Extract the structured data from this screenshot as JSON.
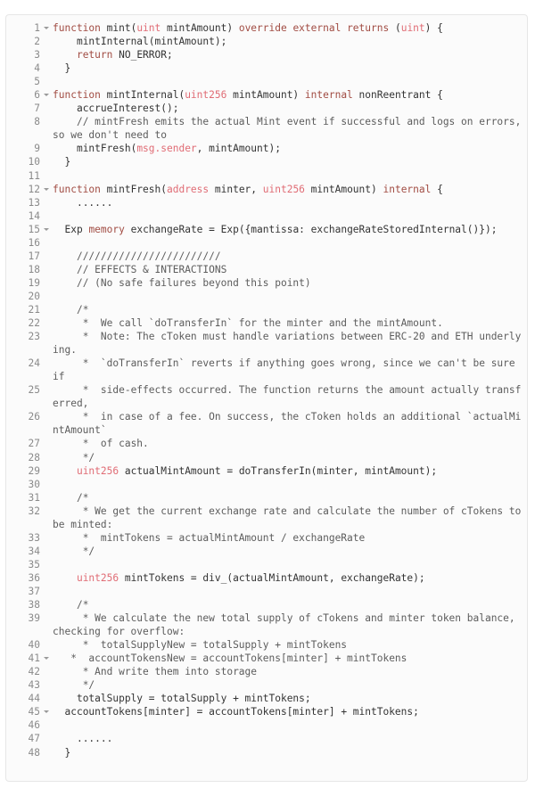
{
  "editor": {
    "language": "solidity",
    "background_color": "#fbfbfb",
    "border_color": "#e6e6e6",
    "line_number_color": "#8a8a8a",
    "keyword_color": "#a14c43",
    "type_color": "#e06c75",
    "comment_color": "#5c5c5c",
    "text_color": "#333333",
    "first_line": 1,
    "last_line": 48,
    "fold_marker_lines": [
      1,
      6,
      12,
      15,
      41,
      45
    ]
  },
  "lines": [
    {
      "n": "1",
      "fold": true,
      "tokens": [
        {
          "t": "kw",
          "v": "function"
        },
        {
          "t": "pln",
          "v": " mint("
        },
        {
          "t": "typ",
          "v": "uint"
        },
        {
          "t": "pln",
          "v": " mintAmount) "
        },
        {
          "t": "kw",
          "v": "override external returns"
        },
        {
          "t": "pln",
          "v": " ("
        },
        {
          "t": "typ",
          "v": "uint"
        },
        {
          "t": "pln",
          "v": ") {"
        }
      ]
    },
    {
      "n": "2",
      "fold": false,
      "tokens": [
        {
          "t": "pln",
          "v": "    mintInternal(mintAmount);"
        }
      ]
    },
    {
      "n": "3",
      "fold": false,
      "tokens": [
        {
          "t": "pln",
          "v": "    "
        },
        {
          "t": "kw",
          "v": "return"
        },
        {
          "t": "pln",
          "v": " NO_ERROR;"
        }
      ]
    },
    {
      "n": "4",
      "fold": false,
      "tokens": [
        {
          "t": "pln",
          "v": "  }"
        }
      ]
    },
    {
      "n": "5",
      "fold": false,
      "tokens": [
        {
          "t": "pln",
          "v": ""
        }
      ]
    },
    {
      "n": "6",
      "fold": true,
      "tokens": [
        {
          "t": "kw",
          "v": "function"
        },
        {
          "t": "pln",
          "v": " mintInternal("
        },
        {
          "t": "typ",
          "v": "uint256"
        },
        {
          "t": "pln",
          "v": " mintAmount) "
        },
        {
          "t": "kw",
          "v": "internal"
        },
        {
          "t": "pln",
          "v": " nonReentrant {"
        }
      ]
    },
    {
      "n": "7",
      "fold": false,
      "tokens": [
        {
          "t": "pln",
          "v": "    accrueInterest();"
        }
      ]
    },
    {
      "n": "8",
      "fold": false,
      "tokens": [
        {
          "t": "cmt",
          "v": "    // mintFresh emits the actual Mint event if successful and logs on errors, so we don't need to"
        }
      ]
    },
    {
      "n": "9",
      "fold": false,
      "tokens": [
        {
          "t": "pln",
          "v": "    mintFresh("
        },
        {
          "t": "prop",
          "v": "msg.sender"
        },
        {
          "t": "pln",
          "v": ", mintAmount);"
        }
      ]
    },
    {
      "n": "10",
      "fold": false,
      "tokens": [
        {
          "t": "pln",
          "v": "  }"
        }
      ]
    },
    {
      "n": "11",
      "fold": false,
      "tokens": [
        {
          "t": "pln",
          "v": ""
        }
      ]
    },
    {
      "n": "12",
      "fold": true,
      "tokens": [
        {
          "t": "kw",
          "v": "function"
        },
        {
          "t": "pln",
          "v": " mintFresh("
        },
        {
          "t": "typ",
          "v": "address"
        },
        {
          "t": "pln",
          "v": " minter, "
        },
        {
          "t": "typ",
          "v": "uint256"
        },
        {
          "t": "pln",
          "v": " mintAmount) "
        },
        {
          "t": "kw",
          "v": "internal"
        },
        {
          "t": "pln",
          "v": " {"
        }
      ]
    },
    {
      "n": "13",
      "fold": false,
      "tokens": [
        {
          "t": "pln",
          "v": "    ......"
        }
      ]
    },
    {
      "n": "14",
      "fold": false,
      "tokens": [
        {
          "t": "pln",
          "v": ""
        }
      ]
    },
    {
      "n": "15",
      "fold": true,
      "tokens": [
        {
          "t": "pln",
          "v": "  Exp "
        },
        {
          "t": "kw",
          "v": "memory"
        },
        {
          "t": "pln",
          "v": " exchangeRate = Exp({mantissa: exchangeRateStoredInternal()});"
        }
      ]
    },
    {
      "n": "16",
      "fold": false,
      "tokens": [
        {
          "t": "pln",
          "v": ""
        }
      ]
    },
    {
      "n": "17",
      "fold": false,
      "tokens": [
        {
          "t": "cmt",
          "v": "    ////////////////////////"
        }
      ]
    },
    {
      "n": "18",
      "fold": false,
      "tokens": [
        {
          "t": "cmt",
          "v": "    // EFFECTS & INTERACTIONS"
        }
      ]
    },
    {
      "n": "19",
      "fold": false,
      "tokens": [
        {
          "t": "cmt",
          "v": "    // (No safe failures beyond this point)"
        }
      ]
    },
    {
      "n": "20",
      "fold": false,
      "tokens": [
        {
          "t": "pln",
          "v": ""
        }
      ]
    },
    {
      "n": "21",
      "fold": false,
      "tokens": [
        {
          "t": "cmt",
          "v": "    /*"
        }
      ]
    },
    {
      "n": "22",
      "fold": false,
      "tokens": [
        {
          "t": "cmt",
          "v": "     *  We call `doTransferIn` for the minter and the mintAmount."
        }
      ]
    },
    {
      "n": "23",
      "fold": false,
      "tokens": [
        {
          "t": "cmt",
          "v": "     *  Note: The cToken must handle variations between ERC-20 and ETH underlying."
        }
      ]
    },
    {
      "n": "24",
      "fold": false,
      "tokens": [
        {
          "t": "cmt",
          "v": "     *  `doTransferIn` reverts if anything goes wrong, since we can't be sure if"
        }
      ]
    },
    {
      "n": "25",
      "fold": false,
      "tokens": [
        {
          "t": "cmt",
          "v": "     *  side-effects occurred. The function returns the amount actually transferred,"
        }
      ]
    },
    {
      "n": "26",
      "fold": false,
      "tokens": [
        {
          "t": "cmt",
          "v": "     *  in case of a fee. On success, the cToken holds an additional `actualMintAmount`"
        }
      ]
    },
    {
      "n": "27",
      "fold": false,
      "tokens": [
        {
          "t": "cmt",
          "v": "     *  of cash."
        }
      ]
    },
    {
      "n": "28",
      "fold": false,
      "tokens": [
        {
          "t": "cmt",
          "v": "     */"
        }
      ]
    },
    {
      "n": "29",
      "fold": false,
      "tokens": [
        {
          "t": "pln",
          "v": "    "
        },
        {
          "t": "typ",
          "v": "uint256"
        },
        {
          "t": "pln",
          "v": " actualMintAmount = doTransferIn(minter, mintAmount);"
        }
      ]
    },
    {
      "n": "30",
      "fold": false,
      "tokens": [
        {
          "t": "pln",
          "v": ""
        }
      ]
    },
    {
      "n": "31",
      "fold": false,
      "tokens": [
        {
          "t": "cmt",
          "v": "    /*"
        }
      ]
    },
    {
      "n": "32",
      "fold": false,
      "tokens": [
        {
          "t": "cmt",
          "v": "     * We get the current exchange rate and calculate the number of cTokens to be minted:"
        }
      ]
    },
    {
      "n": "33",
      "fold": false,
      "tokens": [
        {
          "t": "cmt",
          "v": "     *  mintTokens = actualMintAmount / exchangeRate"
        }
      ]
    },
    {
      "n": "34",
      "fold": false,
      "tokens": [
        {
          "t": "cmt",
          "v": "     */"
        }
      ]
    },
    {
      "n": "35",
      "fold": false,
      "tokens": [
        {
          "t": "pln",
          "v": ""
        }
      ]
    },
    {
      "n": "36",
      "fold": false,
      "tokens": [
        {
          "t": "pln",
          "v": "    "
        },
        {
          "t": "typ",
          "v": "uint256"
        },
        {
          "t": "pln",
          "v": " mintTokens = div_(actualMintAmount, exchangeRate);"
        }
      ]
    },
    {
      "n": "37",
      "fold": false,
      "tokens": [
        {
          "t": "pln",
          "v": ""
        }
      ]
    },
    {
      "n": "38",
      "fold": false,
      "tokens": [
        {
          "t": "cmt",
          "v": "    /*"
        }
      ]
    },
    {
      "n": "39",
      "fold": false,
      "tokens": [
        {
          "t": "cmt",
          "v": "     * We calculate the new total supply of cTokens and minter token balance, checking for overflow:"
        }
      ]
    },
    {
      "n": "40",
      "fold": false,
      "tokens": [
        {
          "t": "cmt",
          "v": "     *  totalSupplyNew = totalSupply + mintTokens"
        }
      ]
    },
    {
      "n": "41",
      "fold": true,
      "tokens": [
        {
          "t": "cmt",
          "v": "   *  accountTokensNew = accountTokens[minter] + mintTokens"
        }
      ]
    },
    {
      "n": "42",
      "fold": false,
      "tokens": [
        {
          "t": "cmt",
          "v": "     * And write them into storage"
        }
      ]
    },
    {
      "n": "43",
      "fold": false,
      "tokens": [
        {
          "t": "cmt",
          "v": "     */"
        }
      ]
    },
    {
      "n": "44",
      "fold": false,
      "tokens": [
        {
          "t": "pln",
          "v": "    totalSupply = totalSupply + mintTokens;"
        }
      ]
    },
    {
      "n": "45",
      "fold": true,
      "tokens": [
        {
          "t": "pln",
          "v": "  accountTokens[minter] = accountTokens[minter] + mintTokens;"
        }
      ]
    },
    {
      "n": "46",
      "fold": false,
      "tokens": [
        {
          "t": "pln",
          "v": ""
        }
      ]
    },
    {
      "n": "47",
      "fold": false,
      "tokens": [
        {
          "t": "pln",
          "v": "    ......"
        }
      ]
    },
    {
      "n": "48",
      "fold": false,
      "tokens": [
        {
          "t": "pln",
          "v": "  }"
        }
      ]
    }
  ]
}
